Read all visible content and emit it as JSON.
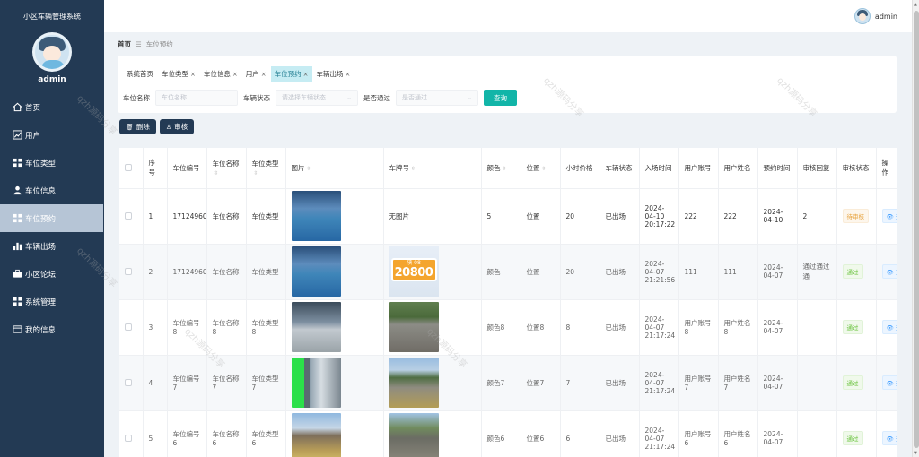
{
  "app_title": "小区车辆管理系统",
  "sidebar": {
    "username": "admin",
    "items": [
      {
        "label": "首页",
        "icon": "home-icon",
        "active": false
      },
      {
        "label": "用户",
        "icon": "chart-line-icon",
        "active": false
      },
      {
        "label": "车位类型",
        "icon": "grid-icon",
        "active": false
      },
      {
        "label": "车位信息",
        "icon": "person-icon",
        "active": false
      },
      {
        "label": "车位预约",
        "icon": "grid-icon",
        "active": true
      },
      {
        "label": "车辆出场",
        "icon": "bar-chart-icon",
        "active": false
      },
      {
        "label": "小区论坛",
        "icon": "briefcase-icon",
        "active": false
      },
      {
        "label": "系统管理",
        "icon": "grid-icon",
        "active": false
      },
      {
        "label": "我的信息",
        "icon": "card-icon",
        "active": false
      }
    ]
  },
  "topbar": {
    "username": "admin"
  },
  "breadcrumb": {
    "home": "首页",
    "separator": "☰",
    "current": "车位预约"
  },
  "tabs": [
    {
      "label": "系统首页",
      "closable": false,
      "active": false
    },
    {
      "label": "车位类型",
      "closable": true,
      "active": false
    },
    {
      "label": "车位信息",
      "closable": true,
      "active": false
    },
    {
      "label": "用户",
      "closable": true,
      "active": false
    },
    {
      "label": "车位预约",
      "closable": true,
      "active": true
    },
    {
      "label": "车辆出场",
      "closable": true,
      "active": false
    }
  ],
  "filters": {
    "name_label": "车位名称",
    "name_placeholder": "车位名称",
    "status_label": "车辆状态",
    "status_placeholder": "请选择车辆状态",
    "pass_label": "是否通过",
    "pass_placeholder": "是否通过",
    "query_label": "查询"
  },
  "actions": {
    "delete_label": "删除",
    "review_label": "审核"
  },
  "table": {
    "headers": [
      "序号",
      "车位编号",
      "车位名称",
      "车位类型",
      "图片",
      "车牌号",
      "颜色",
      "位置",
      "小时价格",
      "车辆状态",
      "入场时间",
      "用户账号",
      "用户姓名",
      "预约时间",
      "审核回复",
      "审核状态",
      "操作"
    ],
    "rows": [
      {
        "idx": "1",
        "code": "1712496083478",
        "name": "车位名称",
        "type": "车位类型",
        "pic": "pic-a",
        "plate": "无图片",
        "plate_img": false,
        "color": "5",
        "pos": "位置",
        "price": "20",
        "status": "已出场",
        "in_time": "2024-04-10 20:17:22",
        "account": "222",
        "uname": "222",
        "reserve": "2024-04-10",
        "reply": "2",
        "audit": "待审核",
        "audit_type": "warn",
        "op": "查看"
      },
      {
        "idx": "2",
        "code": "1712496083478",
        "name": "车位名称",
        "type": "车位类型",
        "pic": "pic-a",
        "plate": "",
        "plate_img": true,
        "plate_top": "陕 08",
        "plate_num": "20800",
        "color": "颜色",
        "pos": "位置",
        "price": "20",
        "status": "已出场",
        "in_time": "2024-04-07 21:21:56",
        "account": "111",
        "uname": "111",
        "reserve": "2024-04-07",
        "reply": "通过通过通",
        "audit": "通过",
        "audit_type": "ok",
        "op": "查看"
      },
      {
        "idx": "3",
        "code": "车位编号8",
        "name": "车位名称8",
        "type": "车位类型8",
        "pic": "pic-b",
        "plate": "",
        "plate_img": false,
        "plate_pic": "pic-e",
        "color": "颜色8",
        "pos": "位置8",
        "price": "8",
        "status": "已出场",
        "in_time": "2024-04-07 21:17:24",
        "account": "用户账号8",
        "uname": "用户姓名8",
        "reserve": "2024-04-07",
        "reply": "",
        "audit": "通过",
        "audit_type": "ok",
        "op": "查看"
      },
      {
        "idx": "4",
        "code": "车位编号7",
        "name": "车位名称7",
        "type": "车位类型7",
        "pic": "pic-c",
        "plate": "",
        "plate_img": false,
        "plate_pic": "pic-f",
        "color": "颜色7",
        "pos": "位置7",
        "price": "7",
        "status": "已出场",
        "in_time": "2024-04-07 21:17:24",
        "account": "用户账号7",
        "uname": "用户姓名7",
        "reserve": "2024-04-07",
        "reply": "",
        "audit": "通过",
        "audit_type": "ok",
        "op": "查看"
      },
      {
        "idx": "5",
        "code": "车位编号6",
        "name": "车位名称6",
        "type": "车位类型6",
        "pic": "pic-d",
        "plate": "",
        "plate_img": false,
        "plate_pic": "pic-g",
        "color": "颜色6",
        "pos": "位置6",
        "price": "6",
        "status": "已出场",
        "in_time": "2024-04-07 21:17:24",
        "account": "用户账号6",
        "uname": "用户姓名6",
        "reserve": "2024-04-07",
        "reply": "",
        "audit": "通过",
        "audit_type": "ok",
        "op": "查看"
      }
    ]
  },
  "colors": {
    "sidebar": "#233a54",
    "accent": "#12b5a8",
    "active_tab": "#c6ecf3"
  }
}
